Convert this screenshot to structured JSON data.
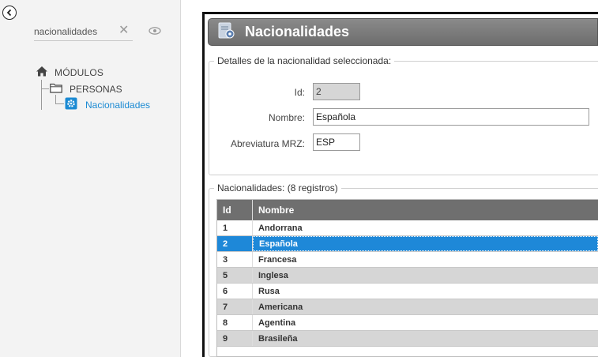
{
  "sidebar": {
    "search_value": "nacionalidades",
    "tree": {
      "root_label": "MÓDULOS",
      "group_label": "PERSONAS",
      "item_label": "Nacionalidades"
    }
  },
  "main": {
    "title": "Nacionalidades",
    "details": {
      "legend": "Detalles de la nacionalidad seleccionada:",
      "id_label": "Id:",
      "id_value": "2",
      "name_label": "Nombre:",
      "name_value": "Española",
      "mrz_label": "Abreviatura MRZ:",
      "mrz_value": "ESP"
    },
    "list": {
      "legend": "Nacionalidades:  (8 registros)",
      "columns": [
        "Id",
        "Nombre"
      ],
      "rows": [
        {
          "id": "1",
          "name": "Andorrana"
        },
        {
          "id": "2",
          "name": "Española"
        },
        {
          "id": "3",
          "name": "Francesa"
        },
        {
          "id": "5",
          "name": "Inglesa"
        },
        {
          "id": "6",
          "name": "Rusa"
        },
        {
          "id": "7",
          "name": "Americana"
        },
        {
          "id": "8",
          "name": "Agentina"
        },
        {
          "id": "9",
          "name": "Brasileña"
        }
      ]
    }
  },
  "colors": {
    "accent": "#1e88d8",
    "link": "#1b8ad3",
    "header": "#6f6f6f"
  }
}
